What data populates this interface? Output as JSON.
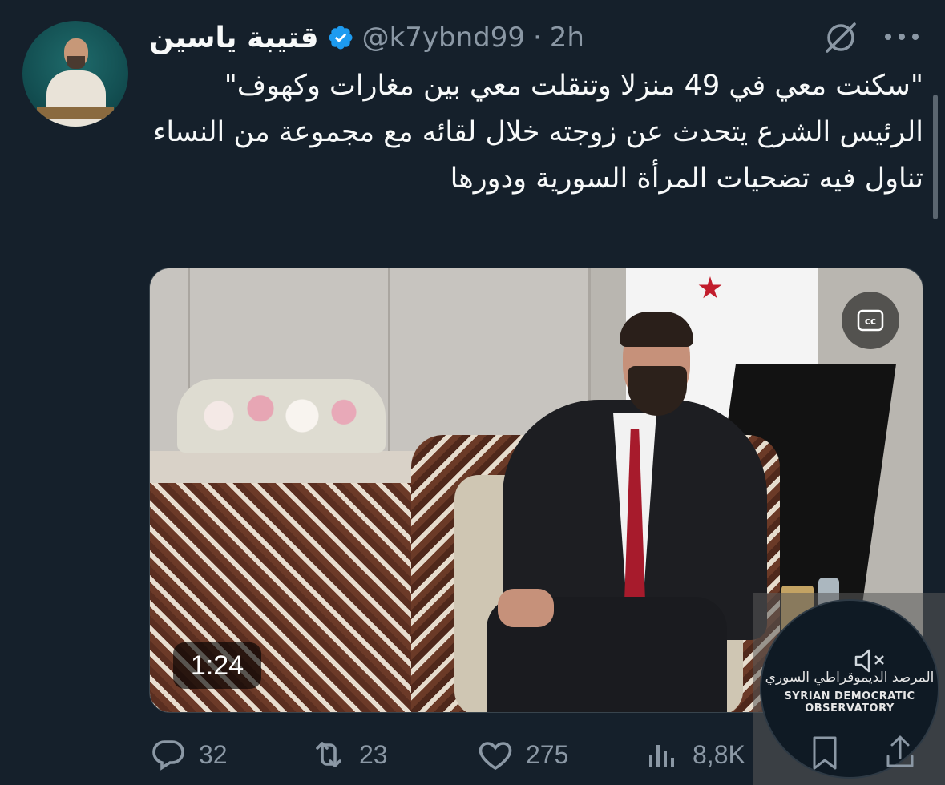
{
  "author": {
    "name": "قتيبة ياسين",
    "handle": "@k7ybnd99",
    "separator": "·",
    "time": "2h",
    "verified": true,
    "verified_color": "#1d9bf0"
  },
  "tweet": {
    "lines": [
      "\"سكنت معي في 49 منزلا وتنقلت معي بين مغارات وكهوف\"",
      "الرئيس الشرع يتحدث عن زوجته خلال لقائه مع مجموعة من النساء تناول فيه تضحيات المرأة السورية ودورها"
    ]
  },
  "video": {
    "duration": "1:24",
    "cc_icon": "cc-icon",
    "watermark_arabic": "المرصد الديموقراطي السوري",
    "watermark_english": "SYRIAN DEMOCRATIC OBSERVATORY"
  },
  "metrics": {
    "replies": "32",
    "reposts": "23",
    "likes": "275",
    "views": "8,8K"
  },
  "colors": {
    "background": "#15202b",
    "text": "#f7f9f9",
    "muted": "#8b98a5"
  }
}
